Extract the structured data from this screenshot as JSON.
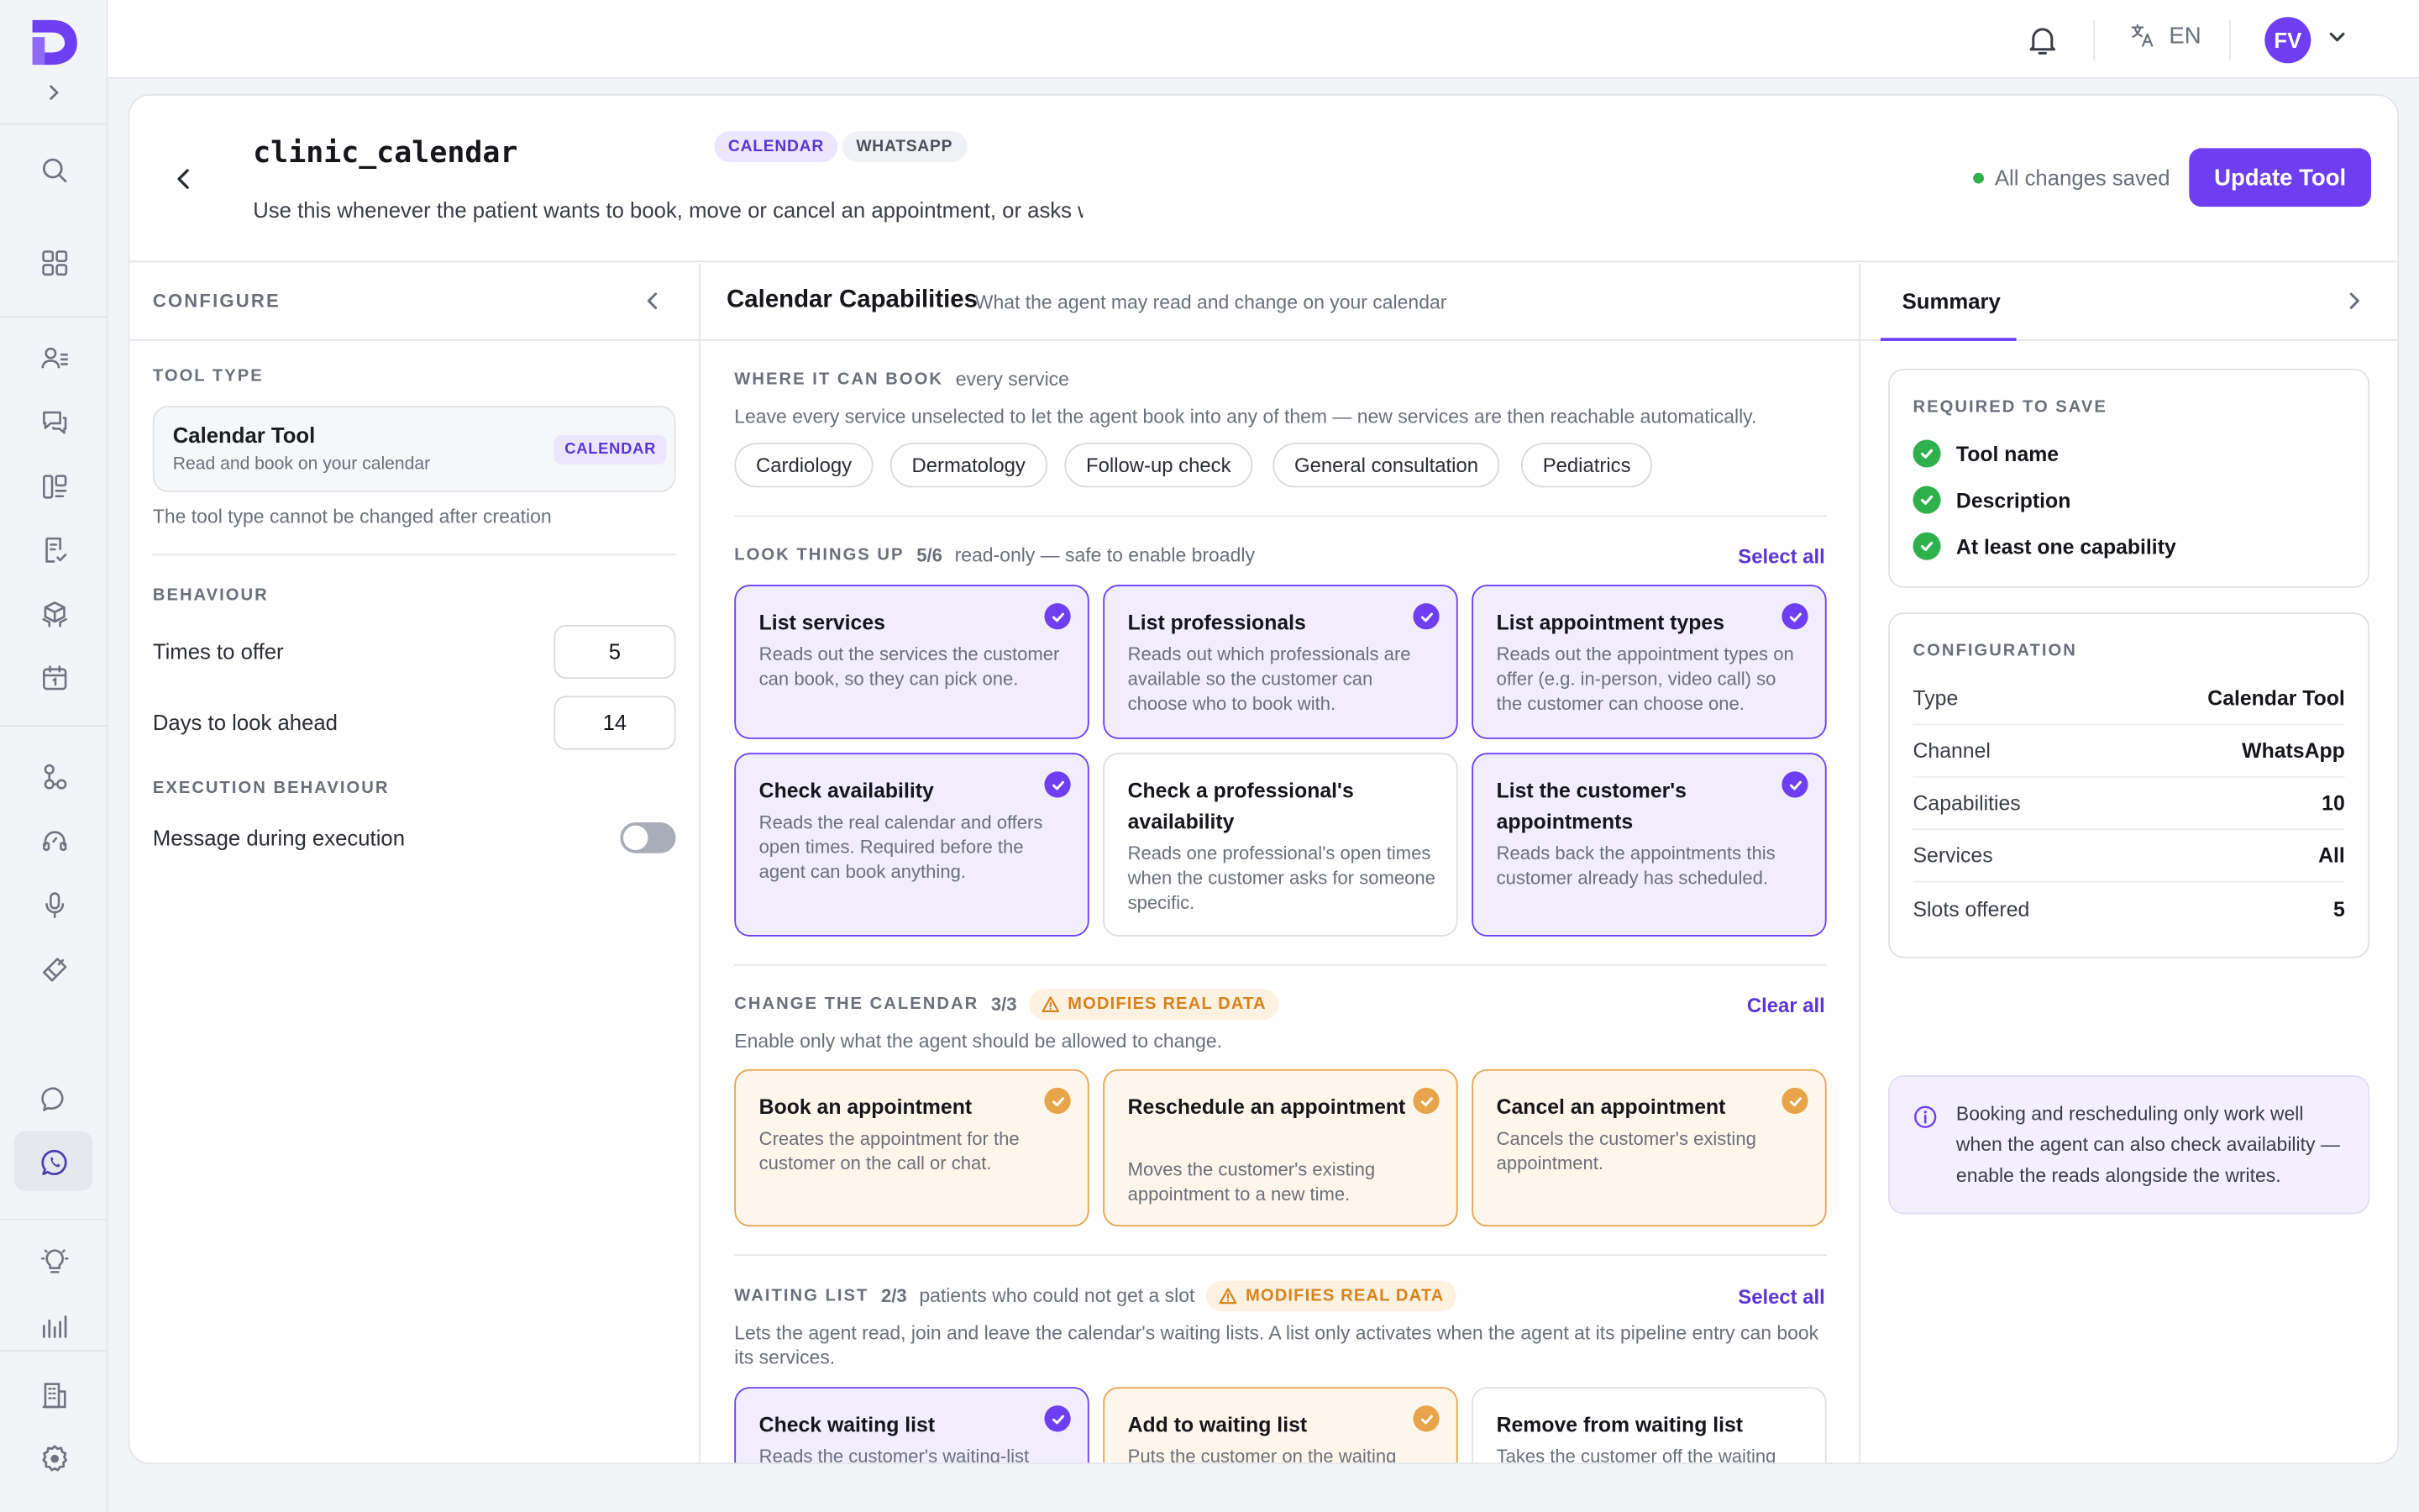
{
  "topbar": {
    "language": "EN",
    "avatar_initials": "FV"
  },
  "header": {
    "tool_name": "clinic_calendar",
    "tags": [
      "CALENDAR",
      "WHATSAPP"
    ],
    "description": "Use this whenever the patient wants to book, move or cancel an appointment, or asks what times are available.",
    "save_status": "All changes saved",
    "update_button": "Update Tool"
  },
  "configure": {
    "title": "CONFIGURE",
    "tool_type_label": "TOOL TYPE",
    "tool_type_name": "Calendar Tool",
    "tool_type_sub": "Read and book on your calendar",
    "tool_type_tag": "CALENDAR",
    "tool_type_note": "The tool type cannot be changed after creation",
    "behaviour_label": "BEHAVIOUR",
    "times_to_offer_label": "Times to offer",
    "times_to_offer_value": "5",
    "days_ahead_label": "Days to look ahead",
    "days_ahead_value": "14",
    "execution_label": "EXECUTION BEHAVIOUR",
    "message_during_execution_label": "Message during execution",
    "message_during_execution_on": false
  },
  "capabilities": {
    "title": "Calendar Capabilities",
    "subtitle": "What the agent may read and change on your calendar",
    "where": {
      "label": "WHERE IT CAN BOOK",
      "note": "every service",
      "description": "Leave every service unselected to let the agent book into any of them — new services are then reachable automatically.",
      "services": [
        "Cardiology",
        "Dermatology",
        "Follow-up check",
        "General consultation",
        "Pediatrics"
      ]
    },
    "lookup": {
      "label": "LOOK THINGS UP",
      "count": "5/6",
      "note": "read-only — safe to enable broadly",
      "action": "Select all",
      "items": [
        {
          "title": "List services",
          "desc": "Reads out the services the customer can book, so they can pick one.",
          "on": true
        },
        {
          "title": "List professionals",
          "desc": "Reads out which professionals are available so the customer can choose who to book with.",
          "on": true
        },
        {
          "title": "List appointment types",
          "desc": "Reads out the appointment types on offer (e.g. in-person, video call) so the customer can choose one.",
          "on": true
        },
        {
          "title": "Check availability",
          "desc": "Reads the real calendar and offers open times. Required before the agent can book anything.",
          "on": true
        },
        {
          "title": "Check a professional's availability",
          "desc": "Reads one professional's open times when the customer asks for someone specific.",
          "on": false
        },
        {
          "title": "List the customer's appointments",
          "desc": "Reads back the appointments this customer already has scheduled.",
          "on": true
        }
      ]
    },
    "change": {
      "label": "CHANGE THE CALENDAR",
      "count": "3/3",
      "warning": "MODIFIES REAL DATA",
      "action": "Clear all",
      "description": "Enable only what the agent should be allowed to change.",
      "items": [
        {
          "title": "Book an appointment",
          "desc": "Creates the appointment for the customer on the call or chat."
        },
        {
          "title": "Reschedule an appointment",
          "desc": "Moves the customer's existing appointment to a new time."
        },
        {
          "title": "Cancel an appointment",
          "desc": "Cancels the customer's existing appointment."
        }
      ]
    },
    "waiting": {
      "label": "WAITING LIST",
      "count": "2/3",
      "note": "patients who could not get a slot",
      "warning": "MODIFIES REAL DATA",
      "action": "Select all",
      "description": "Lets the agent read, join and leave the calendar's waiting lists. A list only activates when the agent at its pipeline entry can book its services.",
      "items": [
        {
          "title": "Check waiting list",
          "desc": "Reads the customer's waiting-list"
        },
        {
          "title": "Add to waiting list",
          "desc": "Puts the customer on the waiting"
        },
        {
          "title": "Remove from waiting list",
          "desc": "Takes the customer off the waiting"
        }
      ]
    }
  },
  "summary": {
    "tab": "Summary",
    "required_label": "REQUIRED TO SAVE",
    "required": [
      "Tool name",
      "Description",
      "At least one capability"
    ],
    "configuration_label": "CONFIGURATION",
    "configuration": [
      {
        "key": "Type",
        "value": "Calendar Tool"
      },
      {
        "key": "Channel",
        "value": "WhatsApp"
      },
      {
        "key": "Capabilities",
        "value": "10"
      },
      {
        "key": "Services",
        "value": "All"
      },
      {
        "key": "Slots offered",
        "value": "5"
      }
    ],
    "info": "Booking and rescheduling only work well when the agent can also check availability — enable the reads alongside the writes."
  },
  "colors": {
    "accent": "#6d3ef2",
    "success": "#2fb04c",
    "warning": "#e8a44a"
  }
}
